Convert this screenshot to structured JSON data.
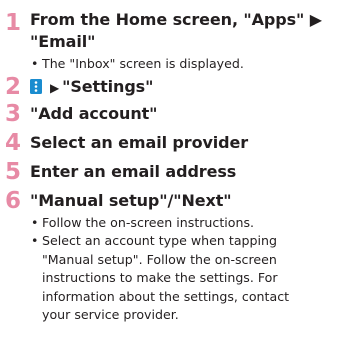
{
  "steps": [
    {
      "number": "1",
      "lines": [
        "From the Home screen, \"Apps\" ▶",
        "\"Email\""
      ],
      "notes": [
        "The \"Inbox\" screen is displayed."
      ]
    },
    {
      "number": "2",
      "icon": "menu-icon",
      "arrow": "▶",
      "text": "\"Settings\"",
      "notes": []
    },
    {
      "number": "3",
      "text": "\"Add account\"",
      "notes": []
    },
    {
      "number": "4",
      "text": "Select an email provider",
      "notes": []
    },
    {
      "number": "5",
      "text": "Enter an email address",
      "notes": []
    },
    {
      "number": "6",
      "text": "\"Manual setup\"/\"Next\"",
      "notes": [
        [
          "Follow the on-screen instructions."
        ],
        [
          "Select an account type when tapping",
          "\"Manual setup\". Follow the on-screen",
          "instructions to make the settings. For",
          "information about the settings, contact",
          "your service provider."
        ]
      ]
    }
  ],
  "bullet_char": "•",
  "colors": {
    "step_number": "#e78aa5",
    "icon_fill": "#1a8ccf",
    "text": "#231f20"
  }
}
